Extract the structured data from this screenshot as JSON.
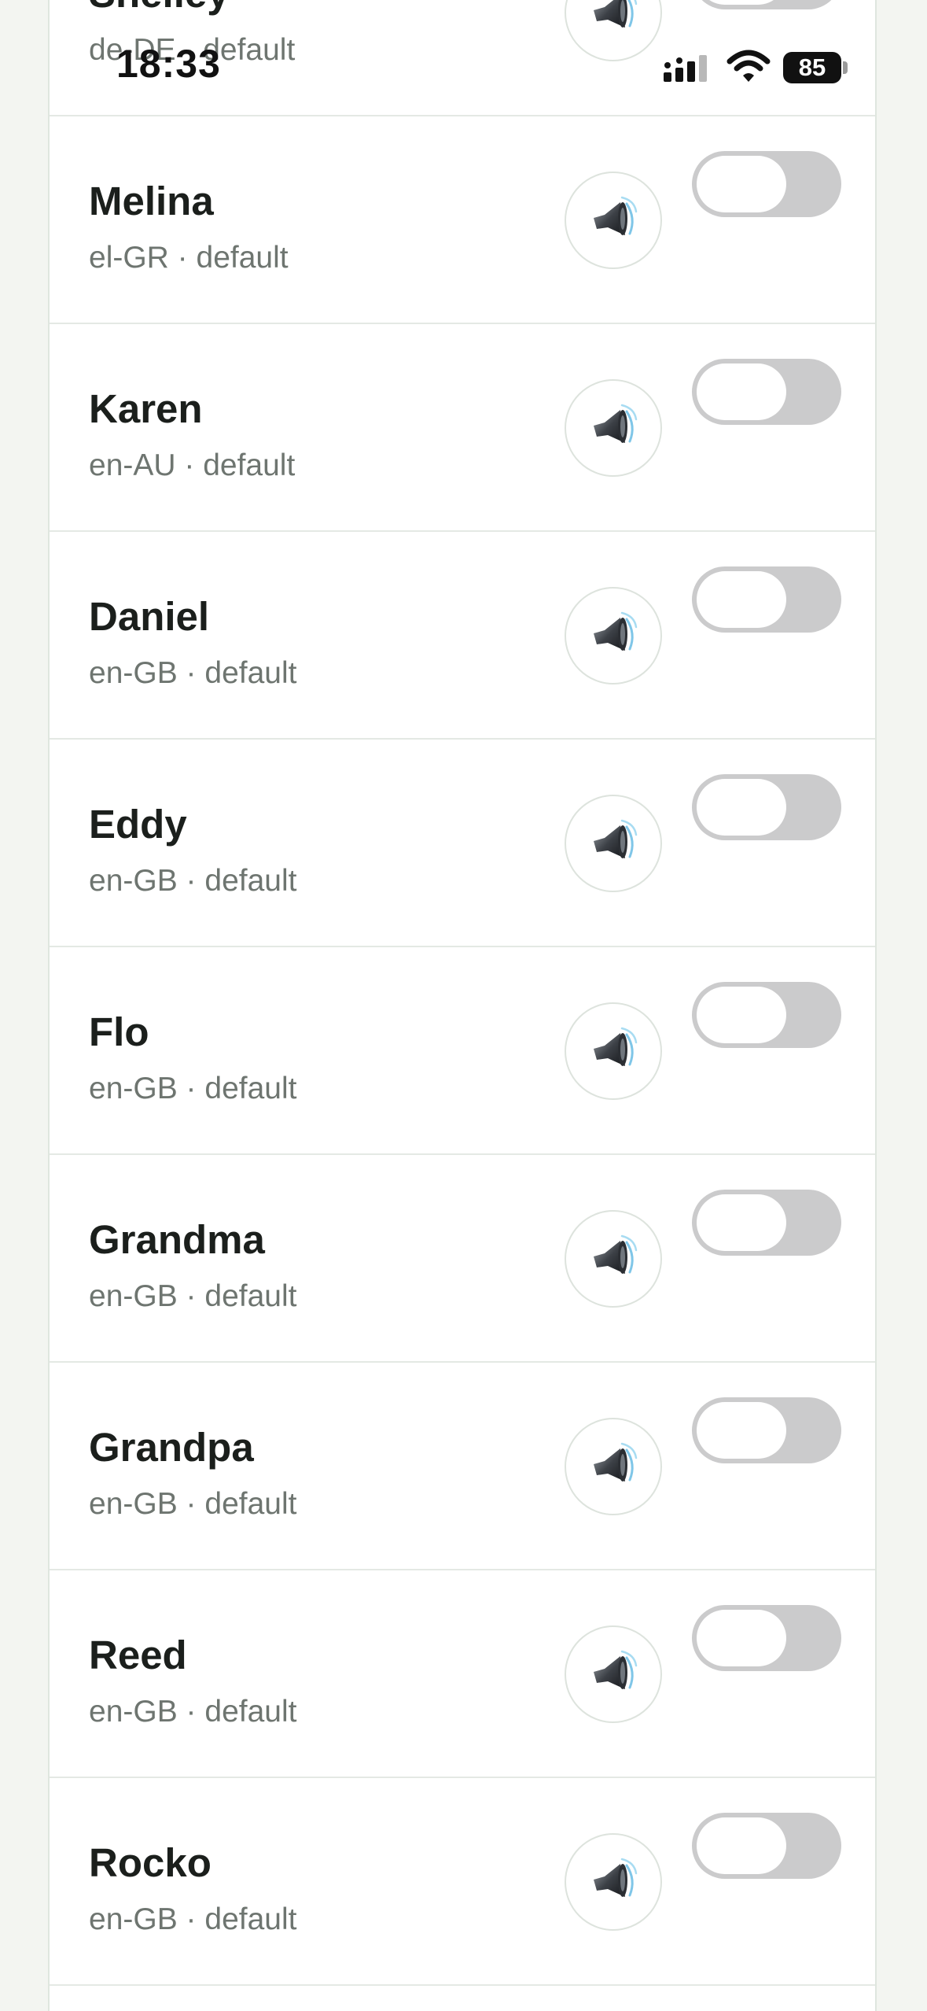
{
  "status_bar": {
    "time": "18:33",
    "battery": "85",
    "signal_icon": "cellular-signal-icon",
    "wifi_icon": "wifi-icon"
  },
  "voices": [
    {
      "name": "Shelley",
      "meta": "de-DE · default",
      "enabled": false
    },
    {
      "name": "Melina",
      "meta": "el-GR · default",
      "enabled": false
    },
    {
      "name": "Karen",
      "meta": "en-AU · default",
      "enabled": false
    },
    {
      "name": "Daniel",
      "meta": "en-GB · default",
      "enabled": false
    },
    {
      "name": "Eddy",
      "meta": "en-GB · default",
      "enabled": false
    },
    {
      "name": "Flo",
      "meta": "en-GB · default",
      "enabled": false
    },
    {
      "name": "Grandma",
      "meta": "en-GB · default",
      "enabled": false
    },
    {
      "name": "Grandpa",
      "meta": "en-GB · default",
      "enabled": false
    },
    {
      "name": "Reed",
      "meta": "en-GB · default",
      "enabled": false
    },
    {
      "name": "Rocko",
      "meta": "en-GB · default",
      "enabled": false
    }
  ],
  "icons": {
    "preview": "speaker-icon"
  },
  "colors": {
    "toggle_off": "#cbcbcc",
    "page_background": "#f3f5f1"
  }
}
